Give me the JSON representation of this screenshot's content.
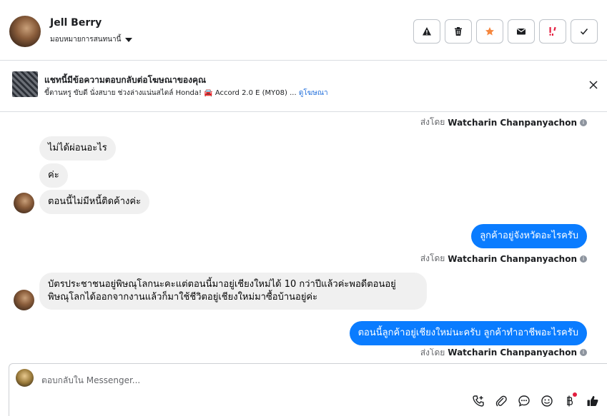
{
  "header": {
    "name": "Jell Berry",
    "assign_label": "มอบหมายการสนทนานี้",
    "actions": [
      "warning-icon",
      "trash-icon",
      "star-icon",
      "envelope-icon",
      "spam-icon",
      "check-icon"
    ]
  },
  "ad": {
    "title": "แชทนี้มีข้อความตอบกลับต่อโฆษณาของคุณ",
    "subtitle": "ขี้ตานหรู ขับดี นั่งสบาย ช่วงล่างแน่นสไตล์ Honda! 🚘 Accord 2.0 E (MY08) ...",
    "link": "ดูโฆษณา"
  },
  "conversation": {
    "sent_prefix": "ส่งโดย",
    "sender": "Watcharin Chanpanyachon",
    "messages": [
      {
        "side": "in",
        "text": "ไม่ได้ผ่อนอะไร"
      },
      {
        "side": "in",
        "text": "ค่ะ"
      },
      {
        "side": "in",
        "text": "ตอนนี้ไม่มีหนี้ติดค้างค่ะ"
      },
      {
        "side": "out",
        "text": "ลูกค้าอยู่จังหวัดอะไรครับ"
      },
      {
        "side": "in",
        "text": "บัตรประชาชนอยู่พิษณุโลกนะคะแต่ตอนนี้มาอยู่เชียงใหม่ได้ 10 กว่าปีแล้วค่ะพอดีตอนอยู่",
        "text2": "พิษณุโลกได้ออกจากงานแล้วก็มาใช้ชีวิตอยู่เชียงใหม่มาซื้อบ้านอยู่ค่ะ"
      },
      {
        "side": "out",
        "text": "ตอนนี้ลูกค้าอยู่เชียงใหม่นะครับ ลูกค้าทำอาชีพอะไรครับ"
      }
    ]
  },
  "composer": {
    "placeholder": "ตอบกลับใน Messenger...",
    "tools": [
      "call-add-icon",
      "paperclip-icon",
      "chat-bubble-icon",
      "emoji-icon",
      "baht-icon",
      "thumbs-up-icon"
    ]
  }
}
